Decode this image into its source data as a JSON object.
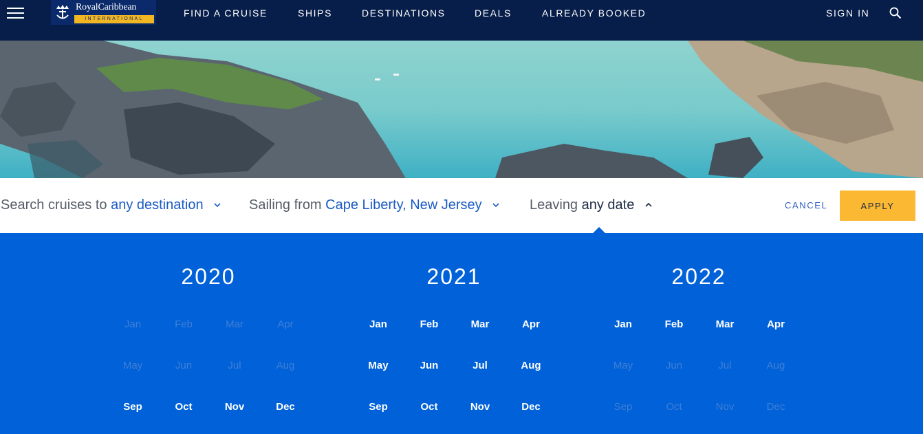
{
  "header": {
    "brand": {
      "name": "RoyalCaribbean",
      "sub": "INTERNATIONAL"
    },
    "nav": [
      "FIND A CRUISE",
      "SHIPS",
      "DESTINATIONS",
      "DEALS",
      "ALREADY BOOKED"
    ],
    "sign_in": "SIGN IN"
  },
  "filters": {
    "destination": {
      "prefix": "Search cruises to",
      "value": "any destination"
    },
    "port": {
      "prefix": "Sailing from",
      "value": "Cape Liberty, New Jersey"
    },
    "date": {
      "prefix": "Leaving",
      "value": "any date"
    },
    "cancel": "CANCEL",
    "apply": "APPLY"
  },
  "calendar": {
    "years": [
      {
        "year": "2020",
        "months": [
          {
            "label": "Jan",
            "enabled": false
          },
          {
            "label": "Feb",
            "enabled": false
          },
          {
            "label": "Mar",
            "enabled": false
          },
          {
            "label": "Apr",
            "enabled": false
          },
          {
            "label": "May",
            "enabled": false
          },
          {
            "label": "Jun",
            "enabled": false
          },
          {
            "label": "Jul",
            "enabled": false
          },
          {
            "label": "Aug",
            "enabled": false
          },
          {
            "label": "Sep",
            "enabled": true
          },
          {
            "label": "Oct",
            "enabled": true
          },
          {
            "label": "Nov",
            "enabled": true
          },
          {
            "label": "Dec",
            "enabled": true
          }
        ]
      },
      {
        "year": "2021",
        "months": [
          {
            "label": "Jan",
            "enabled": true
          },
          {
            "label": "Feb",
            "enabled": true
          },
          {
            "label": "Mar",
            "enabled": true
          },
          {
            "label": "Apr",
            "enabled": true
          },
          {
            "label": "May",
            "enabled": true
          },
          {
            "label": "Jun",
            "enabled": true
          },
          {
            "label": "Jul",
            "enabled": true
          },
          {
            "label": "Aug",
            "enabled": true
          },
          {
            "label": "Sep",
            "enabled": true
          },
          {
            "label": "Oct",
            "enabled": true
          },
          {
            "label": "Nov",
            "enabled": true
          },
          {
            "label": "Dec",
            "enabled": true
          }
        ]
      },
      {
        "year": "2022",
        "months": [
          {
            "label": "Jan",
            "enabled": true
          },
          {
            "label": "Feb",
            "enabled": true
          },
          {
            "label": "Mar",
            "enabled": true
          },
          {
            "label": "Apr",
            "enabled": true
          },
          {
            "label": "May",
            "enabled": false
          },
          {
            "label": "Jun",
            "enabled": false
          },
          {
            "label": "Jul",
            "enabled": false
          },
          {
            "label": "Aug",
            "enabled": false
          },
          {
            "label": "Sep",
            "enabled": false
          },
          {
            "label": "Oct",
            "enabled": false
          },
          {
            "label": "Nov",
            "enabled": false
          },
          {
            "label": "Dec",
            "enabled": false
          }
        ]
      }
    ]
  },
  "colors": {
    "nav_bg": "#081e4a",
    "accent": "#fbb832",
    "calendar_bg": "#0061d8",
    "link": "#1a5bc4"
  }
}
